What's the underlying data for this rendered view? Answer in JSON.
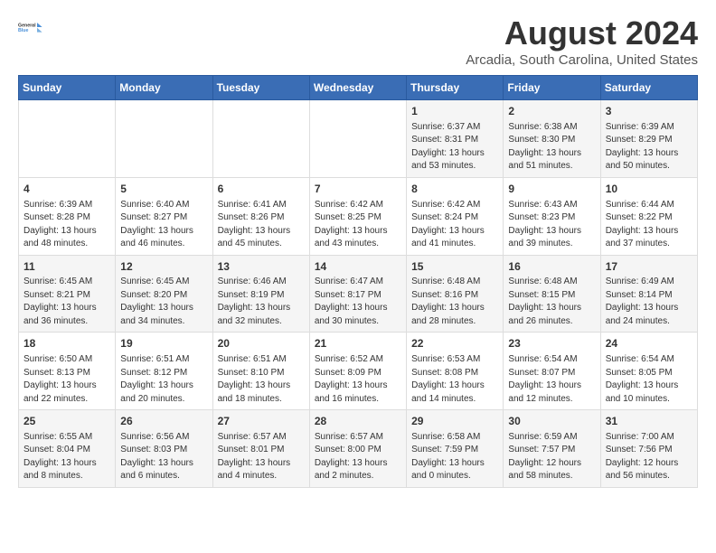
{
  "header": {
    "logo_line1": "General",
    "logo_line2": "Blue",
    "main_title": "August 2024",
    "subtitle": "Arcadia, South Carolina, United States"
  },
  "days_of_week": [
    "Sunday",
    "Monday",
    "Tuesday",
    "Wednesday",
    "Thursday",
    "Friday",
    "Saturday"
  ],
  "weeks": [
    [
      {
        "day": "",
        "info": ""
      },
      {
        "day": "",
        "info": ""
      },
      {
        "day": "",
        "info": ""
      },
      {
        "day": "",
        "info": ""
      },
      {
        "day": "1",
        "info": "Sunrise: 6:37 AM\nSunset: 8:31 PM\nDaylight: 13 hours\nand 53 minutes."
      },
      {
        "day": "2",
        "info": "Sunrise: 6:38 AM\nSunset: 8:30 PM\nDaylight: 13 hours\nand 51 minutes."
      },
      {
        "day": "3",
        "info": "Sunrise: 6:39 AM\nSunset: 8:29 PM\nDaylight: 13 hours\nand 50 minutes."
      }
    ],
    [
      {
        "day": "4",
        "info": "Sunrise: 6:39 AM\nSunset: 8:28 PM\nDaylight: 13 hours\nand 48 minutes."
      },
      {
        "day": "5",
        "info": "Sunrise: 6:40 AM\nSunset: 8:27 PM\nDaylight: 13 hours\nand 46 minutes."
      },
      {
        "day": "6",
        "info": "Sunrise: 6:41 AM\nSunset: 8:26 PM\nDaylight: 13 hours\nand 45 minutes."
      },
      {
        "day": "7",
        "info": "Sunrise: 6:42 AM\nSunset: 8:25 PM\nDaylight: 13 hours\nand 43 minutes."
      },
      {
        "day": "8",
        "info": "Sunrise: 6:42 AM\nSunset: 8:24 PM\nDaylight: 13 hours\nand 41 minutes."
      },
      {
        "day": "9",
        "info": "Sunrise: 6:43 AM\nSunset: 8:23 PM\nDaylight: 13 hours\nand 39 minutes."
      },
      {
        "day": "10",
        "info": "Sunrise: 6:44 AM\nSunset: 8:22 PM\nDaylight: 13 hours\nand 37 minutes."
      }
    ],
    [
      {
        "day": "11",
        "info": "Sunrise: 6:45 AM\nSunset: 8:21 PM\nDaylight: 13 hours\nand 36 minutes."
      },
      {
        "day": "12",
        "info": "Sunrise: 6:45 AM\nSunset: 8:20 PM\nDaylight: 13 hours\nand 34 minutes."
      },
      {
        "day": "13",
        "info": "Sunrise: 6:46 AM\nSunset: 8:19 PM\nDaylight: 13 hours\nand 32 minutes."
      },
      {
        "day": "14",
        "info": "Sunrise: 6:47 AM\nSunset: 8:17 PM\nDaylight: 13 hours\nand 30 minutes."
      },
      {
        "day": "15",
        "info": "Sunrise: 6:48 AM\nSunset: 8:16 PM\nDaylight: 13 hours\nand 28 minutes."
      },
      {
        "day": "16",
        "info": "Sunrise: 6:48 AM\nSunset: 8:15 PM\nDaylight: 13 hours\nand 26 minutes."
      },
      {
        "day": "17",
        "info": "Sunrise: 6:49 AM\nSunset: 8:14 PM\nDaylight: 13 hours\nand 24 minutes."
      }
    ],
    [
      {
        "day": "18",
        "info": "Sunrise: 6:50 AM\nSunset: 8:13 PM\nDaylight: 13 hours\nand 22 minutes."
      },
      {
        "day": "19",
        "info": "Sunrise: 6:51 AM\nSunset: 8:12 PM\nDaylight: 13 hours\nand 20 minutes."
      },
      {
        "day": "20",
        "info": "Sunrise: 6:51 AM\nSunset: 8:10 PM\nDaylight: 13 hours\nand 18 minutes."
      },
      {
        "day": "21",
        "info": "Sunrise: 6:52 AM\nSunset: 8:09 PM\nDaylight: 13 hours\nand 16 minutes."
      },
      {
        "day": "22",
        "info": "Sunrise: 6:53 AM\nSunset: 8:08 PM\nDaylight: 13 hours\nand 14 minutes."
      },
      {
        "day": "23",
        "info": "Sunrise: 6:54 AM\nSunset: 8:07 PM\nDaylight: 13 hours\nand 12 minutes."
      },
      {
        "day": "24",
        "info": "Sunrise: 6:54 AM\nSunset: 8:05 PM\nDaylight: 13 hours\nand 10 minutes."
      }
    ],
    [
      {
        "day": "25",
        "info": "Sunrise: 6:55 AM\nSunset: 8:04 PM\nDaylight: 13 hours\nand 8 minutes."
      },
      {
        "day": "26",
        "info": "Sunrise: 6:56 AM\nSunset: 8:03 PM\nDaylight: 13 hours\nand 6 minutes."
      },
      {
        "day": "27",
        "info": "Sunrise: 6:57 AM\nSunset: 8:01 PM\nDaylight: 13 hours\nand 4 minutes."
      },
      {
        "day": "28",
        "info": "Sunrise: 6:57 AM\nSunset: 8:00 PM\nDaylight: 13 hours\nand 2 minutes."
      },
      {
        "day": "29",
        "info": "Sunrise: 6:58 AM\nSunset: 7:59 PM\nDaylight: 13 hours\nand 0 minutes."
      },
      {
        "day": "30",
        "info": "Sunrise: 6:59 AM\nSunset: 7:57 PM\nDaylight: 12 hours\nand 58 minutes."
      },
      {
        "day": "31",
        "info": "Sunrise: 7:00 AM\nSunset: 7:56 PM\nDaylight: 12 hours\nand 56 minutes."
      }
    ]
  ]
}
